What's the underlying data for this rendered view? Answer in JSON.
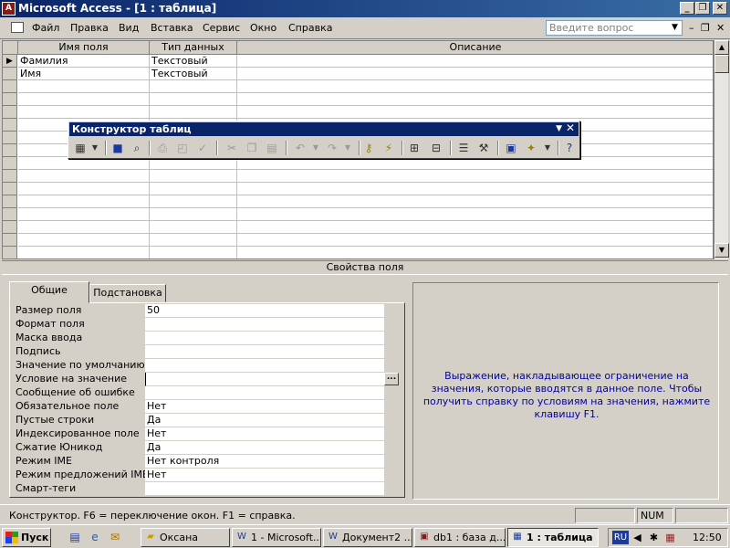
{
  "window": {
    "title": "Microsoft Access - [1 : таблица]",
    "controls": {
      "minimize": "_",
      "restore": "❐",
      "close": "✕"
    }
  },
  "menubar": {
    "items": [
      "Файл",
      "Правка",
      "Вид",
      "Вставка",
      "Сервис",
      "Окно",
      "Справка"
    ],
    "help_placeholder": "Введите вопрос",
    "mdi_controls": {
      "minimize": "–",
      "restore": "❐",
      "close": "✕"
    }
  },
  "design_grid": {
    "columns": [
      "Имя поля",
      "Тип данных",
      "Описание"
    ],
    "rows": [
      {
        "name": "Фамилия",
        "type": "Текстовый",
        "description": ""
      },
      {
        "name": "Имя",
        "type": "Текстовый",
        "description": ""
      }
    ],
    "current_row_marker": "▶"
  },
  "toolbar": {
    "title": "Конструктор таблиц",
    "icons": [
      "view-icon",
      "save-icon",
      "search-icon",
      "print-icon",
      "preview-icon",
      "spelling-icon",
      "cut-icon",
      "copy-icon",
      "paste-icon",
      "undo-icon",
      "redo-icon",
      "primary-key-icon",
      "indexes-icon",
      "insert-rows-icon",
      "delete-rows-icon",
      "properties-icon",
      "build-icon",
      "database-window-icon",
      "new-object-icon",
      "help-icon"
    ]
  },
  "field_properties": {
    "caption": "Свойства поля",
    "tabs": [
      "Общие",
      "Подстановка"
    ],
    "active_tab": 0,
    "properties": [
      {
        "label": "Размер поля",
        "value": "50"
      },
      {
        "label": "Формат поля",
        "value": ""
      },
      {
        "label": "Маска ввода",
        "value": ""
      },
      {
        "label": "Подпись",
        "value": ""
      },
      {
        "label": "Значение по умолчанию",
        "value": ""
      },
      {
        "label": "Условие на значение",
        "value": ""
      },
      {
        "label": "Сообщение об ошибке",
        "value": ""
      },
      {
        "label": "Обязательное поле",
        "value": "Нет"
      },
      {
        "label": "Пустые строки",
        "value": "Да"
      },
      {
        "label": "Индексированное поле",
        "value": "Нет"
      },
      {
        "label": "Сжатие Юникод",
        "value": "Да"
      },
      {
        "label": "Режим IME",
        "value": "Нет контроля"
      },
      {
        "label": "Режим предложений IME",
        "value": "Нет"
      },
      {
        "label": "Смарт-теги",
        "value": ""
      }
    ],
    "build_button_label": "...",
    "hint": "Выражение, накладывающее ограничение на значения, которые вводятся в данное поле.  Чтобы получить справку по условиям на значения, нажмите клавишу F1."
  },
  "statusbar": {
    "text": "Конструктор.  F6 = переключение окон.  F1 = справка.",
    "num": "NUM"
  },
  "taskbar": {
    "start_label": "Пуск",
    "tasks": [
      {
        "label": "Оксана",
        "icon": "folder-icon",
        "active": false
      },
      {
        "label": "1 - Microsoft...",
        "icon": "word-icon",
        "active": false
      },
      {
        "label": "Документ2 ...",
        "icon": "word-icon",
        "active": false
      },
      {
        "label": "db1 : база д...",
        "icon": "access-icon",
        "active": false
      },
      {
        "label": "1 : таблица",
        "icon": "table-icon",
        "active": true
      }
    ],
    "tray": {
      "language": "RU",
      "clock": "12:50"
    }
  }
}
